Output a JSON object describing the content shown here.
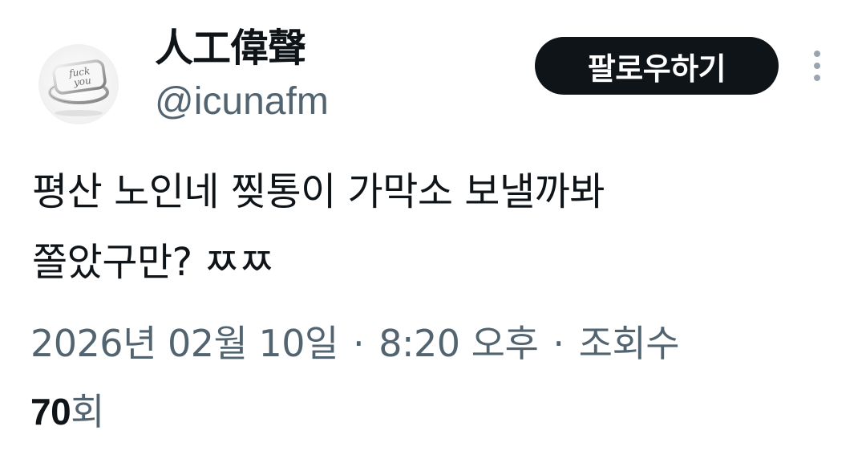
{
  "author": {
    "display_name": "人工偉聲",
    "handle": "@icunafm",
    "avatar_icon": "ring-avatar-icon",
    "avatar_text": "fuck you"
  },
  "actions": {
    "follow_label": "팔로우하기",
    "more_icon": "more-vertical-icon"
  },
  "tweet": {
    "lines": [
      "평산 노인네 찢통이 가막소 보낼까봐",
      "쫄았구만? ㅉㅉ"
    ]
  },
  "meta": {
    "date": "2026년 02월 10일",
    "separator": "·",
    "time": "8:20 오후",
    "views_label": "조회수",
    "views_count": "70",
    "views_unit": "회"
  },
  "colors": {
    "text_primary": "#0f1419",
    "text_secondary": "#536471",
    "button_bg": "#0f1419",
    "button_text": "#ffffff",
    "more_dots": "#9aa5b1"
  }
}
